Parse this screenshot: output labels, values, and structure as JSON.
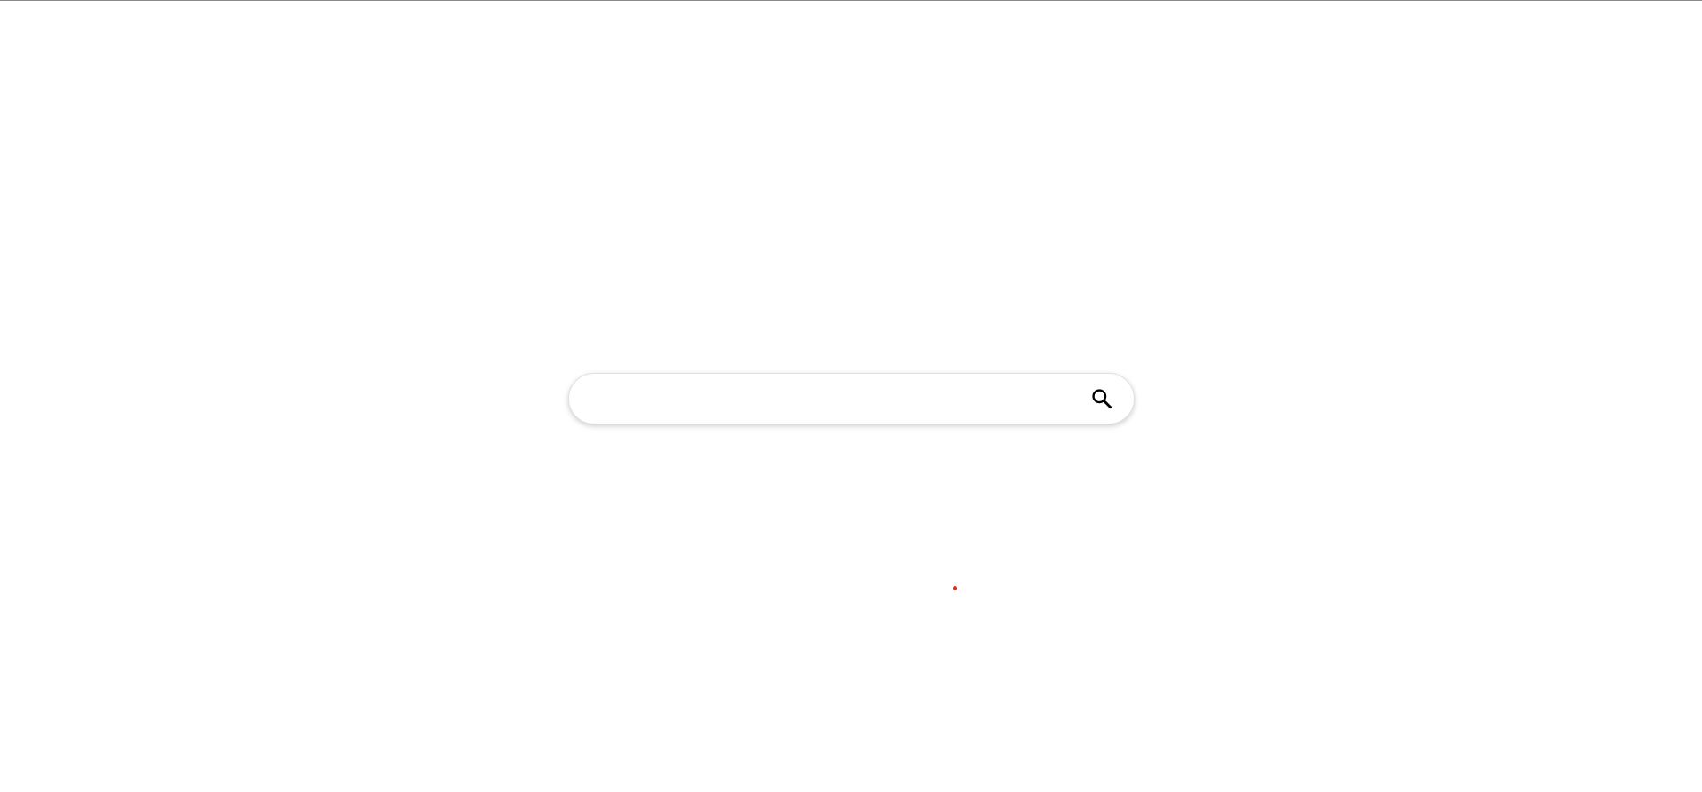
{
  "search": {
    "value": "",
    "placeholder": "",
    "button_icon": "search-icon"
  },
  "indicator": {
    "icon": "dot",
    "color": "#d93025"
  },
  "colors": {
    "background": "#ffffff",
    "top_border": "#8a8a8a",
    "search_border": "#dfe1e5",
    "icon": "#000000"
  }
}
